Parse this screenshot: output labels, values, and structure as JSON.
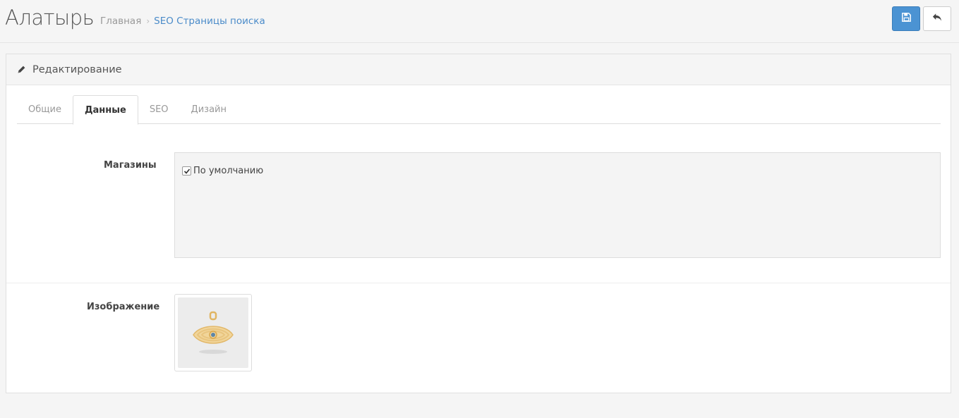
{
  "header": {
    "title": "Алатырь",
    "breadcrumb": [
      "Главная",
      "SEO Страницы поиска"
    ],
    "breadcrumb_sep": "›"
  },
  "actions": {
    "save_icon": "save-icon",
    "back_icon": "reply-icon"
  },
  "panel": {
    "title": "Редактирование",
    "icon": "pencil-icon"
  },
  "tabs": [
    {
      "label": "Общие",
      "active": false
    },
    {
      "label": "Данные",
      "active": true
    },
    {
      "label": "SEO",
      "active": false
    },
    {
      "label": "Дизайн",
      "active": false
    }
  ],
  "form": {
    "stores_label": "Магазины",
    "stores": [
      {
        "label": "По умолчанию",
        "checked": true
      }
    ],
    "image_label": "Изображение"
  },
  "colors": {
    "accent": "#4b93d3",
    "link": "#4a8bc9"
  }
}
